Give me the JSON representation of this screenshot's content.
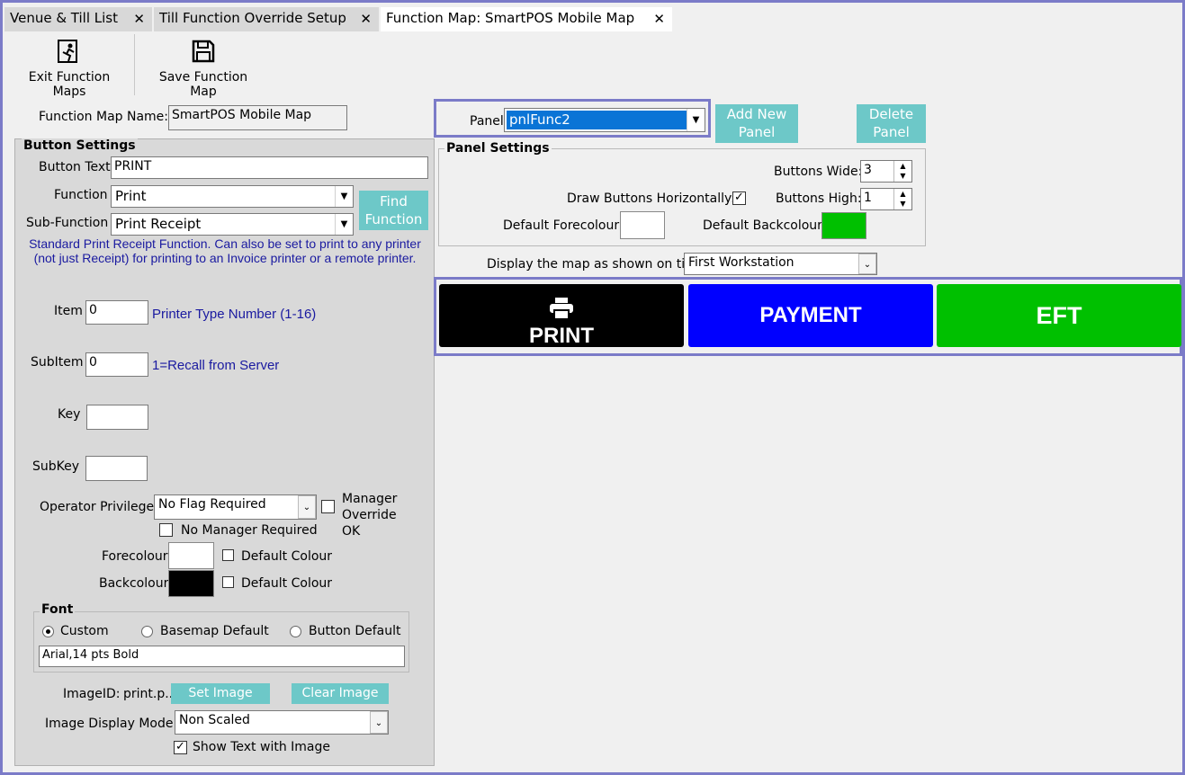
{
  "tabs": [
    {
      "label": "Venue & Till List"
    },
    {
      "label": "Till Function Override Setup"
    },
    {
      "label": "Function Map: SmartPOS Mobile Map"
    }
  ],
  "toolbar": {
    "exit_label": "Exit Function Maps",
    "save_label": "Save Function Map"
  },
  "function_map_name": {
    "label": "Function Map Name:",
    "value": "SmartPOS Mobile Map"
  },
  "button_settings": {
    "title": "Button Settings",
    "button_text_label": "Button Text",
    "button_text_value": "PRINT",
    "function_label": "Function",
    "function_value": "Print",
    "sub_function_label": "Sub-Function",
    "sub_function_value": "Print Receipt",
    "find_function_label": "Find Function",
    "description": "Standard Print Receipt Function. Can also be set to print to any printer (not just Receipt) for printing to an Invoice printer or a remote printer.",
    "item_label": "Item",
    "item_value": "0",
    "item_hint": "Printer Type Number (1-16)",
    "subitem_label": "SubItem",
    "subitem_value": "0",
    "subitem_hint": "1=Recall from Server",
    "key_label": "Key",
    "key_value": "",
    "subkey_label": "SubKey",
    "subkey_value": "",
    "operator_privilege_label": "Operator Privilege:",
    "operator_privilege_value": "No Flag Required",
    "manager_override_label": "Manager Override OK",
    "no_manager_required_label": "No Manager Required",
    "forecolour_label": "Forecolour",
    "backcolour_label": "Backcolour",
    "default_colour_label": "Default Colour",
    "forecolour": "#ffffff",
    "backcolour": "#000000"
  },
  "font": {
    "title": "Font",
    "options": [
      "Custom",
      "Basemap Default",
      "Button Default"
    ],
    "selected": "Custom",
    "value": "Arial,14 pts Bold"
  },
  "image": {
    "imageid_label": "ImageID:",
    "imageid_value": "print.p...",
    "set_image_label": "Set Image",
    "clear_image_label": "Clear Image",
    "display_mode_label": "Image Display Mode:",
    "display_mode_value": "Non Scaled",
    "show_text_label": "Show Text with Image",
    "show_text_checked": true
  },
  "panel": {
    "label": "Panel",
    "value": "pnlFunc2",
    "add_new_label": "Add New Panel",
    "delete_label": "Delete Panel"
  },
  "panel_settings": {
    "title": "Panel Settings",
    "buttons_wide_label": "Buttons Wide:",
    "buttons_wide_value": "3",
    "buttons_high_label": "Buttons High:",
    "buttons_high_value": "1",
    "draw_horizontally_label": "Draw Buttons Horizontally:",
    "draw_horizontally_checked": true,
    "default_forecolour_label": "Default Forecolour",
    "default_backcolour_label": "Default Backcolour",
    "default_forecolour": "#ffffff",
    "default_backcolour": "#00c000"
  },
  "display_map": {
    "label": "Display the map as shown on till:",
    "value": "First Workstation"
  },
  "map_buttons": [
    {
      "label": "PRINT",
      "color": "#000000",
      "icon": "printer-icon"
    },
    {
      "label": "PAYMENT",
      "color": "#0000ff"
    },
    {
      "label": "EFT",
      "color": "#00c000"
    }
  ],
  "colors": {
    "accent": "#6dc8c8",
    "frame": "#7b7bc8",
    "hint_blue": "#1a1aa0"
  }
}
